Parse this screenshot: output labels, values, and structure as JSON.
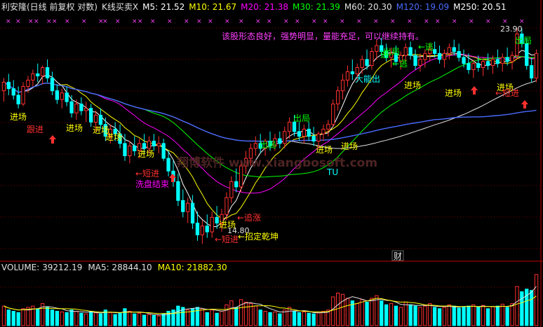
{
  "header": {
    "items": [
      {
        "text": "利安隆(日线 前复权 对数)",
        "color": "#e0e0e0"
      },
      {
        "text": "K线买卖X",
        "color": "#e0e0e0"
      },
      {
        "text": "M5: 21.52",
        "color": "#ffffff"
      },
      {
        "text": "M10: 21.67",
        "color": "#ffff00"
      },
      {
        "text": "M20: 21.38",
        "color": "#ff00ff"
      },
      {
        "text": "M30: 21.39",
        "color": "#00ff00"
      },
      {
        "text": "M60: 20.30",
        "color": "#e0e0e0"
      },
      {
        "text": "M120: 19.09",
        "color": "#4a6bff"
      },
      {
        "text": "M250: 20.51",
        "color": "#ffffff"
      }
    ]
  },
  "volume_header": {
    "items": [
      {
        "text": "VOLUME: 39212.19",
        "color": "#e0e0e0"
      },
      {
        "text": "MA5: 28844.10",
        "color": "#e0e0e0"
      },
      {
        "text": "MA10: 21882.30",
        "color": "#ffff00"
      }
    ]
  },
  "annotations": {
    "comment": "该股形态良好，强势明显，量能充足，可以继续持有。",
    "watermark": "翔博软件 www.xiangbosoft.com",
    "finance_badge": "财",
    "price_high": "23.90",
    "price_low": "14.80",
    "labels": [
      {
        "text": "进场",
        "color": "#ffff00"
      },
      {
        "text": "跟进",
        "color": "#ff3030"
      },
      {
        "text": "进场",
        "color": "#ffff00"
      },
      {
        "text": "进场",
        "color": "#ffff00"
      },
      {
        "text": "进场",
        "color": "#ffff00"
      },
      {
        "text": "进场",
        "color": "#ffff00"
      },
      {
        "text": "←短进",
        "color": "#ff3030"
      },
      {
        "text": "洗盘结束",
        "color": "#ff00ff"
      },
      {
        "text": "←追涨",
        "color": "#ff3030"
      },
      {
        "text": "进场",
        "color": "#ffff00"
      },
      {
        "text": "←短进",
        "color": "#ff3030"
      },
      {
        "text": "←招定乾坤",
        "color": "#ffff00"
      },
      {
        "text": "出局",
        "color": "#00ff00"
      },
      {
        "text": "出局",
        "color": "#00ff00"
      },
      {
        "text": "进场",
        "color": "#ffff00"
      },
      {
        "text": "进场",
        "color": "#ffff00"
      },
      {
        "text": "TU",
        "color": "#00ffff"
      },
      {
        "text": "大能出",
        "color": "#00ffff"
      },
      {
        "text": "逃",
        "color": "#00ff00"
      },
      {
        "text": "出局",
        "color": "#00ff00"
      },
      {
        "text": "←逃",
        "color": "#00ff00"
      },
      {
        "text": "←逃",
        "color": "#00ff00"
      },
      {
        "text": "进场",
        "color": "#ffff00"
      },
      {
        "text": "进场",
        "color": "#ffff00"
      },
      {
        "text": "进场",
        "color": "#ffff00"
      },
      {
        "text": "出局",
        "color": "#00ff00"
      },
      {
        "text": "←短进",
        "color": "#ff3030"
      }
    ]
  },
  "chart_data": {
    "type": "candlestick",
    "price_scale": "log",
    "grid": "dotted red horizontal",
    "colors": {
      "up": "#ff3030",
      "down": "#00ffff",
      "ma5": "#ffffff",
      "ma10": "#ffff00",
      "ma20": "#ff00ff",
      "ma30": "#00ff00",
      "ma60": "#e0e0e0",
      "ma120": "#4a6bff",
      "ma250": "#ffffff",
      "vol_ma5": "#e0e0e0",
      "vol_ma10": "#ffff00"
    },
    "candles": [
      {
        "o": 20.8,
        "h": 21.4,
        "l": 20.3,
        "c": 21.2,
        "v": 15000
      },
      {
        "o": 21.2,
        "h": 21.6,
        "l": 20.6,
        "c": 20.9,
        "v": 12000
      },
      {
        "o": 20.9,
        "h": 21.3,
        "l": 20.4,
        "c": 20.6,
        "v": 11000
      },
      {
        "o": 20.6,
        "h": 21.0,
        "l": 20.0,
        "c": 20.2,
        "v": 10000
      },
      {
        "o": 20.2,
        "h": 21.2,
        "l": 20.1,
        "c": 21.0,
        "v": 13000
      },
      {
        "o": 21.0,
        "h": 21.5,
        "l": 20.7,
        "c": 21.3,
        "v": 14000
      },
      {
        "o": 21.3,
        "h": 21.8,
        "l": 21.0,
        "c": 21.6,
        "v": 15000
      },
      {
        "o": 21.6,
        "h": 22.1,
        "l": 21.2,
        "c": 21.5,
        "v": 13000
      },
      {
        "o": 21.5,
        "h": 22.0,
        "l": 21.1,
        "c": 21.9,
        "v": 17000
      },
      {
        "o": 21.9,
        "h": 22.3,
        "l": 21.2,
        "c": 21.4,
        "v": 14000
      },
      {
        "o": 21.4,
        "h": 21.7,
        "l": 20.6,
        "c": 20.8,
        "v": 12000
      },
      {
        "o": 20.8,
        "h": 21.1,
        "l": 20.2,
        "c": 20.4,
        "v": 11000
      },
      {
        "o": 20.4,
        "h": 20.9,
        "l": 20.0,
        "c": 20.7,
        "v": 10500
      },
      {
        "o": 20.7,
        "h": 21.0,
        "l": 20.1,
        "c": 20.3,
        "v": 10000
      },
      {
        "o": 20.3,
        "h": 20.6,
        "l": 19.6,
        "c": 19.8,
        "v": 12000
      },
      {
        "o": 19.8,
        "h": 20.4,
        "l": 19.5,
        "c": 20.2,
        "v": 11000
      },
      {
        "o": 20.2,
        "h": 20.5,
        "l": 19.7,
        "c": 19.9,
        "v": 9500
      },
      {
        "o": 19.9,
        "h": 20.3,
        "l": 19.4,
        "c": 20.0,
        "v": 9000
      },
      {
        "o": 20.0,
        "h": 20.2,
        "l": 19.2,
        "c": 19.4,
        "v": 11000
      },
      {
        "o": 19.4,
        "h": 19.9,
        "l": 19.0,
        "c": 19.7,
        "v": 9800
      },
      {
        "o": 19.7,
        "h": 20.0,
        "l": 19.1,
        "c": 19.3,
        "v": 9000
      },
      {
        "o": 19.3,
        "h": 19.6,
        "l": 18.6,
        "c": 18.8,
        "v": 12000
      },
      {
        "o": 18.8,
        "h": 19.3,
        "l": 18.5,
        "c": 19.1,
        "v": 10000
      },
      {
        "o": 19.1,
        "h": 19.4,
        "l": 18.6,
        "c": 18.9,
        "v": 8500
      },
      {
        "o": 18.9,
        "h": 19.3,
        "l": 18.3,
        "c": 18.5,
        "v": 10000
      },
      {
        "o": 18.5,
        "h": 18.9,
        "l": 17.8,
        "c": 18.0,
        "v": 13000
      },
      {
        "o": 18.0,
        "h": 18.6,
        "l": 17.7,
        "c": 18.4,
        "v": 11000
      },
      {
        "o": 18.4,
        "h": 18.8,
        "l": 18.0,
        "c": 18.2,
        "v": 9000
      },
      {
        "o": 18.2,
        "h": 18.7,
        "l": 17.9,
        "c": 18.5,
        "v": 9500
      },
      {
        "o": 18.5,
        "h": 18.9,
        "l": 18.1,
        "c": 18.3,
        "v": 8000
      },
      {
        "o": 18.3,
        "h": 18.8,
        "l": 18.1,
        "c": 18.6,
        "v": 8500
      },
      {
        "o": 18.6,
        "h": 18.9,
        "l": 18.2,
        "c": 18.4,
        "v": 7800
      },
      {
        "o": 18.4,
        "h": 18.8,
        "l": 18.1,
        "c": 18.5,
        "v": 7500
      },
      {
        "o": 18.5,
        "h": 18.7,
        "l": 17.8,
        "c": 17.9,
        "v": 9000
      },
      {
        "o": 17.9,
        "h": 18.2,
        "l": 17.2,
        "c": 17.4,
        "v": 11000
      },
      {
        "o": 17.4,
        "h": 17.8,
        "l": 16.8,
        "c": 17.0,
        "v": 12000
      },
      {
        "o": 17.0,
        "h": 17.3,
        "l": 16.1,
        "c": 16.3,
        "v": 15000
      },
      {
        "o": 16.3,
        "h": 16.7,
        "l": 15.7,
        "c": 15.9,
        "v": 14000
      },
      {
        "o": 15.9,
        "h": 16.4,
        "l": 15.5,
        "c": 16.2,
        "v": 12000
      },
      {
        "o": 16.2,
        "h": 16.5,
        "l": 15.3,
        "c": 15.5,
        "v": 13000
      },
      {
        "o": 15.5,
        "h": 15.9,
        "l": 14.9,
        "c": 15.1,
        "v": 14000
      },
      {
        "o": 15.1,
        "h": 15.6,
        "l": 14.8,
        "c": 15.4,
        "v": 13000
      },
      {
        "o": 15.4,
        "h": 15.8,
        "l": 15.0,
        "c": 15.2,
        "v": 10000
      },
      {
        "o": 15.2,
        "h": 15.9,
        "l": 15.0,
        "c": 15.7,
        "v": 12000
      },
      {
        "o": 15.7,
        "h": 16.1,
        "l": 15.3,
        "c": 15.5,
        "v": 9500
      },
      {
        "o": 15.5,
        "h": 16.0,
        "l": 15.2,
        "c": 15.8,
        "v": 11000
      },
      {
        "o": 15.8,
        "h": 16.6,
        "l": 15.6,
        "c": 16.4,
        "v": 16000
      },
      {
        "o": 16.4,
        "h": 17.2,
        "l": 16.2,
        "c": 17.0,
        "v": 19000
      },
      {
        "o": 17.0,
        "h": 17.5,
        "l": 16.6,
        "c": 16.8,
        "v": 14000
      },
      {
        "o": 16.8,
        "h": 17.8,
        "l": 16.6,
        "c": 17.6,
        "v": 20000
      },
      {
        "o": 17.6,
        "h": 18.2,
        "l": 17.3,
        "c": 17.9,
        "v": 18000
      },
      {
        "o": 17.9,
        "h": 18.5,
        "l": 17.6,
        "c": 18.3,
        "v": 17000
      },
      {
        "o": 18.3,
        "h": 18.8,
        "l": 18.0,
        "c": 18.5,
        "v": 15000
      },
      {
        "o": 18.5,
        "h": 18.9,
        "l": 18.1,
        "c": 18.3,
        "v": 12000
      },
      {
        "o": 18.3,
        "h": 18.7,
        "l": 18.0,
        "c": 18.6,
        "v": 11000
      },
      {
        "o": 18.6,
        "h": 19.0,
        "l": 18.2,
        "c": 18.4,
        "v": 10000
      },
      {
        "o": 18.4,
        "h": 18.9,
        "l": 18.2,
        "c": 18.7,
        "v": 10500
      },
      {
        "o": 18.7,
        "h": 19.0,
        "l": 18.3,
        "c": 18.5,
        "v": 9000
      },
      {
        "o": 18.5,
        "h": 19.2,
        "l": 18.3,
        "c": 19.0,
        "v": 12000
      },
      {
        "o": 19.0,
        "h": 19.6,
        "l": 18.7,
        "c": 19.4,
        "v": 14000
      },
      {
        "o": 19.4,
        "h": 19.7,
        "l": 18.8,
        "c": 19.0,
        "v": 11000
      },
      {
        "o": 19.0,
        "h": 19.4,
        "l": 18.6,
        "c": 18.8,
        "v": 10000
      },
      {
        "o": 18.8,
        "h": 19.3,
        "l": 18.5,
        "c": 19.1,
        "v": 10500
      },
      {
        "o": 19.1,
        "h": 19.4,
        "l": 18.6,
        "c": 18.8,
        "v": 9500
      },
      {
        "o": 18.8,
        "h": 19.2,
        "l": 18.4,
        "c": 18.6,
        "v": 9000
      },
      {
        "o": 18.6,
        "h": 19.0,
        "l": 18.3,
        "c": 18.9,
        "v": 9800
      },
      {
        "o": 18.9,
        "h": 19.3,
        "l": 18.6,
        "c": 19.1,
        "v": 11000
      },
      {
        "o": 19.1,
        "h": 19.5,
        "l": 18.8,
        "c": 19.3,
        "v": 12000
      },
      {
        "o": 19.3,
        "h": 20.4,
        "l": 19.2,
        "c": 20.2,
        "v": 22000
      },
      {
        "o": 20.2,
        "h": 21.0,
        "l": 19.9,
        "c": 20.8,
        "v": 25000
      },
      {
        "o": 20.8,
        "h": 21.6,
        "l": 20.4,
        "c": 21.3,
        "v": 24000
      },
      {
        "o": 21.3,
        "h": 22.0,
        "l": 21.0,
        "c": 21.7,
        "v": 21000
      },
      {
        "o": 21.7,
        "h": 22.3,
        "l": 21.3,
        "c": 21.6,
        "v": 19000
      },
      {
        "o": 21.6,
        "h": 22.1,
        "l": 21.2,
        "c": 21.9,
        "v": 17000
      },
      {
        "o": 21.9,
        "h": 22.5,
        "l": 21.6,
        "c": 22.3,
        "v": 20000
      },
      {
        "o": 22.3,
        "h": 22.8,
        "l": 21.8,
        "c": 22.0,
        "v": 18000
      },
      {
        "o": 22.0,
        "h": 22.9,
        "l": 21.8,
        "c": 22.7,
        "v": 21000
      },
      {
        "o": 22.7,
        "h": 23.3,
        "l": 22.3,
        "c": 23.0,
        "v": 23000
      },
      {
        "o": 23.0,
        "h": 23.4,
        "l": 22.5,
        "c": 22.7,
        "v": 19000
      },
      {
        "o": 22.7,
        "h": 23.1,
        "l": 22.2,
        "c": 22.4,
        "v": 16000
      },
      {
        "o": 22.4,
        "h": 22.9,
        "l": 21.9,
        "c": 22.6,
        "v": 17000
      },
      {
        "o": 22.6,
        "h": 23.0,
        "l": 22.0,
        "c": 22.2,
        "v": 15000
      },
      {
        "o": 22.2,
        "h": 22.7,
        "l": 21.8,
        "c": 22.5,
        "v": 14000
      },
      {
        "o": 22.5,
        "h": 23.1,
        "l": 22.2,
        "c": 22.9,
        "v": 18000
      },
      {
        "o": 22.9,
        "h": 23.2,
        "l": 22.3,
        "c": 22.5,
        "v": 16000
      },
      {
        "o": 22.5,
        "h": 22.8,
        "l": 21.8,
        "c": 22.0,
        "v": 15000
      },
      {
        "o": 22.0,
        "h": 22.6,
        "l": 21.7,
        "c": 22.3,
        "v": 14000
      },
      {
        "o": 22.3,
        "h": 22.8,
        "l": 21.9,
        "c": 22.6,
        "v": 15000
      },
      {
        "o": 22.6,
        "h": 23.1,
        "l": 22.2,
        "c": 22.8,
        "v": 17000
      },
      {
        "o": 22.8,
        "h": 23.2,
        "l": 22.4,
        "c": 22.6,
        "v": 14000
      },
      {
        "o": 22.6,
        "h": 23.0,
        "l": 22.1,
        "c": 22.3,
        "v": 13000
      },
      {
        "o": 22.3,
        "h": 22.8,
        "l": 21.9,
        "c": 22.6,
        "v": 14000
      },
      {
        "o": 22.6,
        "h": 23.1,
        "l": 22.3,
        "c": 22.9,
        "v": 16000
      },
      {
        "o": 22.9,
        "h": 23.3,
        "l": 22.5,
        "c": 22.7,
        "v": 15000
      },
      {
        "o": 22.7,
        "h": 23.1,
        "l": 22.2,
        "c": 22.4,
        "v": 13500
      },
      {
        "o": 22.4,
        "h": 22.8,
        "l": 21.9,
        "c": 22.1,
        "v": 14500
      },
      {
        "o": 22.1,
        "h": 22.6,
        "l": 21.6,
        "c": 21.8,
        "v": 15000
      },
      {
        "o": 21.8,
        "h": 22.3,
        "l": 21.4,
        "c": 22.1,
        "v": 16000
      },
      {
        "o": 22.1,
        "h": 22.5,
        "l": 21.7,
        "c": 21.9,
        "v": 14000
      },
      {
        "o": 21.9,
        "h": 22.4,
        "l": 21.5,
        "c": 22.2,
        "v": 15500
      },
      {
        "o": 22.2,
        "h": 22.6,
        "l": 21.8,
        "c": 22.0,
        "v": 13000
      },
      {
        "o": 22.0,
        "h": 22.5,
        "l": 21.6,
        "c": 22.3,
        "v": 14500
      },
      {
        "o": 22.3,
        "h": 22.8,
        "l": 21.9,
        "c": 22.1,
        "v": 15000
      },
      {
        "o": 22.1,
        "h": 22.6,
        "l": 21.7,
        "c": 22.4,
        "v": 16500
      },
      {
        "o": 22.4,
        "h": 22.9,
        "l": 22.0,
        "c": 22.2,
        "v": 14000
      },
      {
        "o": 22.2,
        "h": 22.7,
        "l": 21.8,
        "c": 22.5,
        "v": 17000
      },
      {
        "o": 22.5,
        "h": 23.9,
        "l": 22.3,
        "c": 23.6,
        "v": 30000
      },
      {
        "o": 23.6,
        "h": 23.9,
        "l": 22.9,
        "c": 23.1,
        "v": 26000
      },
      {
        "o": 23.1,
        "h": 23.4,
        "l": 21.8,
        "c": 22.0,
        "v": 28000
      },
      {
        "o": 22.0,
        "h": 22.4,
        "l": 21.2,
        "c": 21.4,
        "v": 27000
      },
      {
        "o": 21.4,
        "h": 22.8,
        "l": 21.2,
        "c": 22.6,
        "v": 39212
      }
    ]
  }
}
